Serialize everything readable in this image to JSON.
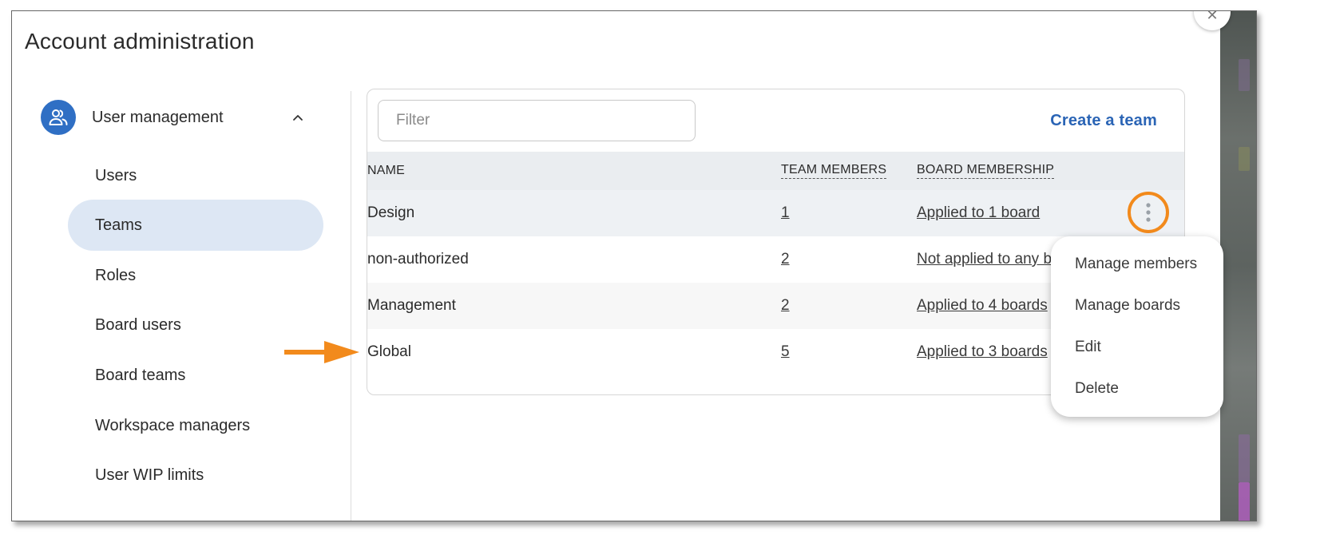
{
  "title": "Account administration",
  "sidebar": {
    "group": {
      "label": "User management",
      "icon": "users-icon",
      "expanded": true
    },
    "items": [
      {
        "label": "Users",
        "active": false
      },
      {
        "label": "Teams",
        "active": true
      },
      {
        "label": "Roles",
        "active": false
      },
      {
        "label": "Board users",
        "active": false
      },
      {
        "label": "Board teams",
        "active": false
      },
      {
        "label": "Workspace managers",
        "active": false
      },
      {
        "label": "User WIP limits",
        "active": false
      }
    ]
  },
  "toolbar": {
    "filter_placeholder": "Filter",
    "create_label": "Create a team"
  },
  "table": {
    "headers": {
      "name": "NAME",
      "members": "TEAM MEMBERS",
      "boards": "BOARD MEMBERSHIP"
    },
    "rows": [
      {
        "name": "Design",
        "members": "1",
        "boards": "Applied to 1 board"
      },
      {
        "name": "non-authorized",
        "members": "2",
        "boards": "Not applied to any b"
      },
      {
        "name": "Management",
        "members": "2",
        "boards": "Applied to 4 boards"
      },
      {
        "name": "Global",
        "members": "5",
        "boards": "Applied to 3 boards"
      }
    ]
  },
  "context_menu": {
    "items": [
      "Manage members",
      "Manage boards",
      "Edit",
      "Delete"
    ]
  },
  "colors": {
    "accent": "#2a64b5",
    "active_nav": "#dde7f4",
    "annotation": "#f28a1c"
  }
}
